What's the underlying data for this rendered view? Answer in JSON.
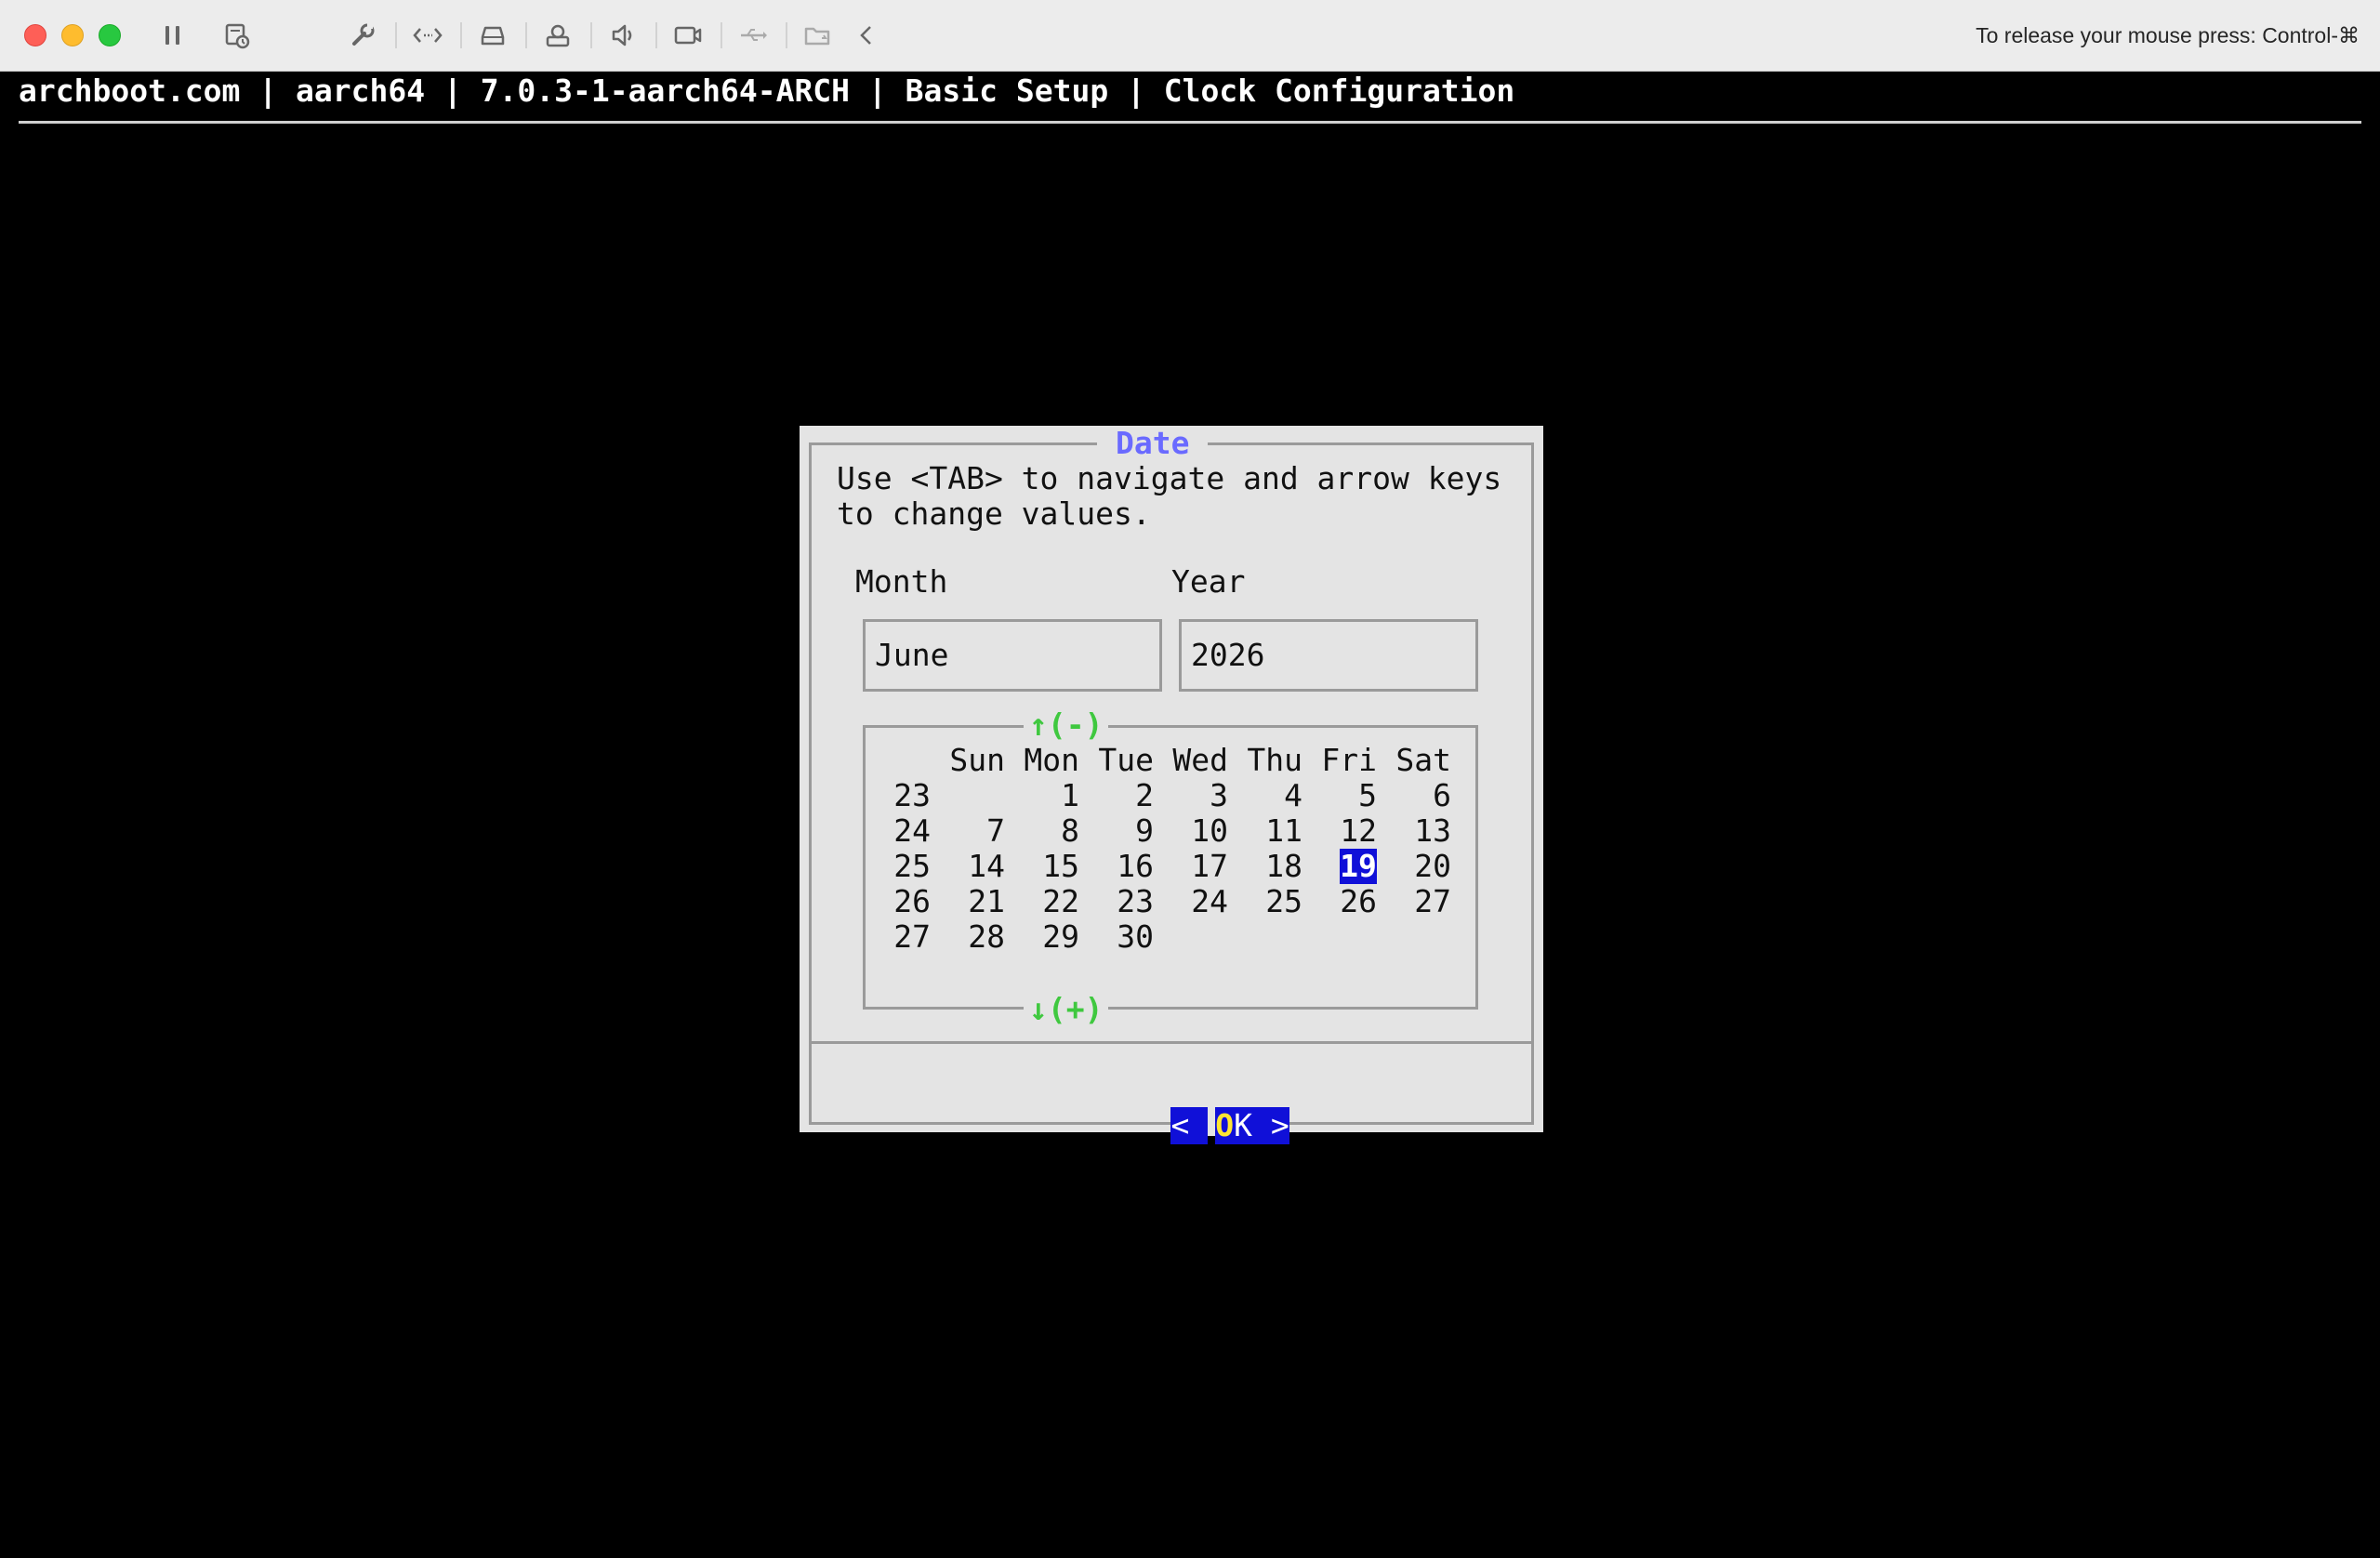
{
  "window": {
    "release_hint": "To release your mouse press: Control-⌘",
    "toolbar_icons": [
      "pause-icon",
      "snapshot-icon",
      "wrench-icon",
      "code-arrows-icon",
      "disk-icon",
      "printer-icon",
      "speaker-icon",
      "camera-icon",
      "usb-icon",
      "shared-folder-icon",
      "collapse-chevron-icon"
    ]
  },
  "terminal": {
    "title": "archboot.com | aarch64 | 7.0.3-1-aarch64-ARCH | Basic Setup | Clock Configuration"
  },
  "dialog": {
    "title": "Date",
    "instructions": "Use <TAB> to navigate and arrow keys\nto change values.",
    "month_label": "Month",
    "month_value": "June",
    "year_label": "Year",
    "year_value": "2026",
    "scroll_up": "↑(-)",
    "scroll_down": "↓(+)",
    "ok_button": {
      "left_bracket": "< ",
      "hot_letter": "O",
      "rest": "K",
      "right_bracket": " >"
    },
    "calendar": {
      "weekdays": [
        "Sun",
        "Mon",
        "Tue",
        "Wed",
        "Thu",
        "Fri",
        "Sat"
      ],
      "weeks": [
        {
          "week": "23",
          "days": [
            "",
            "1",
            "2",
            "3",
            "4",
            "5",
            "6"
          ]
        },
        {
          "week": "24",
          "days": [
            "7",
            "8",
            "9",
            "10",
            "11",
            "12",
            "13"
          ]
        },
        {
          "week": "25",
          "days": [
            "14",
            "15",
            "16",
            "17",
            "18",
            "19",
            "20"
          ]
        },
        {
          "week": "26",
          "days": [
            "21",
            "22",
            "23",
            "24",
            "25",
            "26",
            "27"
          ]
        },
        {
          "week": "27",
          "days": [
            "28",
            "29",
            "30",
            "",
            "",
            "",
            ""
          ]
        }
      ],
      "selected_day": "19"
    }
  },
  "colors": {
    "terminal_bg": "#000000",
    "dialog_bg": "#e4e4e4",
    "title_accent": "#6a6aff",
    "scroll_indicator": "#3fc83f",
    "selection_bg": "#1010d8",
    "hotkey": "#ffe633"
  }
}
